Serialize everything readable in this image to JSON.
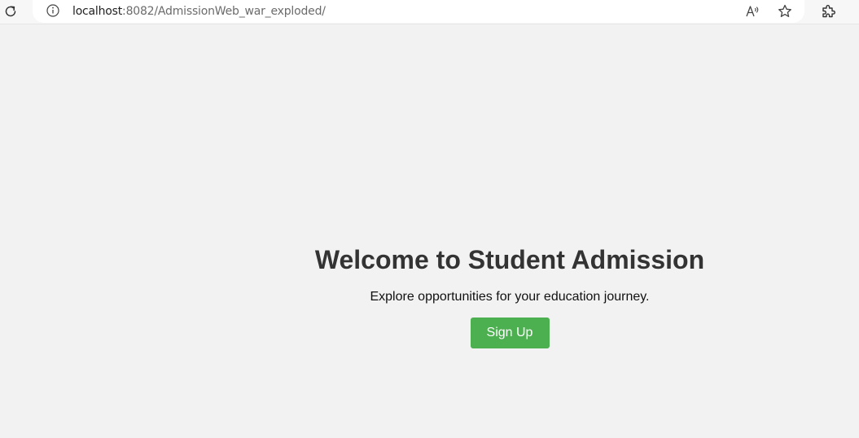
{
  "browser": {
    "url_host": "localhost",
    "url_path": ":8082/AdmissionWeb_war_exploded/",
    "icons": {
      "reload": "reload-icon",
      "site_info": "info-icon",
      "read_aloud": "read-aloud-icon",
      "favorite": "star-icon",
      "extensions": "extensions-icon"
    }
  },
  "hero": {
    "title": "Welcome to Student Admission",
    "subtitle": "Explore opportunities for your education journey.",
    "signup_label": "Sign Up"
  },
  "colors": {
    "page_background": "#f2f2f2",
    "button": "#4caf50",
    "title": "#333333"
  }
}
